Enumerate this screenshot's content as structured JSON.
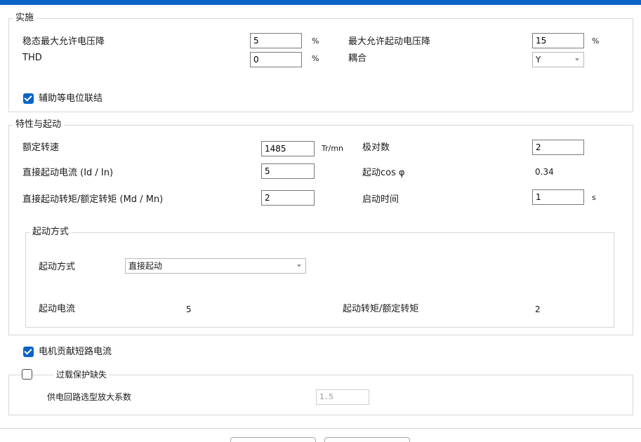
{
  "impl": {
    "legend": "实施",
    "steady_drop_label": "稳态最大允许电压降",
    "steady_drop_value": "5",
    "steady_drop_unit": "%",
    "max_start_drop_label": "最大允许起动电压降",
    "max_start_drop_value": "15",
    "max_start_drop_unit": "%",
    "thd_label": "THD",
    "thd_value": "0",
    "thd_unit": "%",
    "coupling_label": "耦合",
    "coupling_value": "Y",
    "aux_bond_label": "辅助等电位联结"
  },
  "char": {
    "legend": "特性与起动",
    "rated_speed_label": "额定转速",
    "rated_speed_value": "1485",
    "rated_speed_unit": "Tr/mn",
    "pole_pairs_label": "极对数",
    "pole_pairs_value": "2",
    "direct_current_label": "直接起动电流 (Id / In)",
    "direct_current_value": "5",
    "start_cos_label": "起动cos φ",
    "start_cos_value": "0.34",
    "direct_torque_label": "直接起动转矩/额定转矩 (Md / Mn)",
    "direct_torque_value": "2",
    "start_time_label": "启动时间",
    "start_time_value": "1",
    "start_time_unit": "s"
  },
  "start_mode": {
    "legend": "起动方式",
    "mode_label": "起动方式",
    "mode_value": "直接起动",
    "start_current_label": "起动电流",
    "start_current_value": "5",
    "torque_ratio_label": "起动转矩/额定转矩",
    "torque_ratio_value": "2"
  },
  "motor_contrib_label": "电机贡献短路电流",
  "overload": {
    "legend": "过载保护缺失",
    "factor_label": "供电回路选型放大系数",
    "factor_value": "1.5"
  }
}
